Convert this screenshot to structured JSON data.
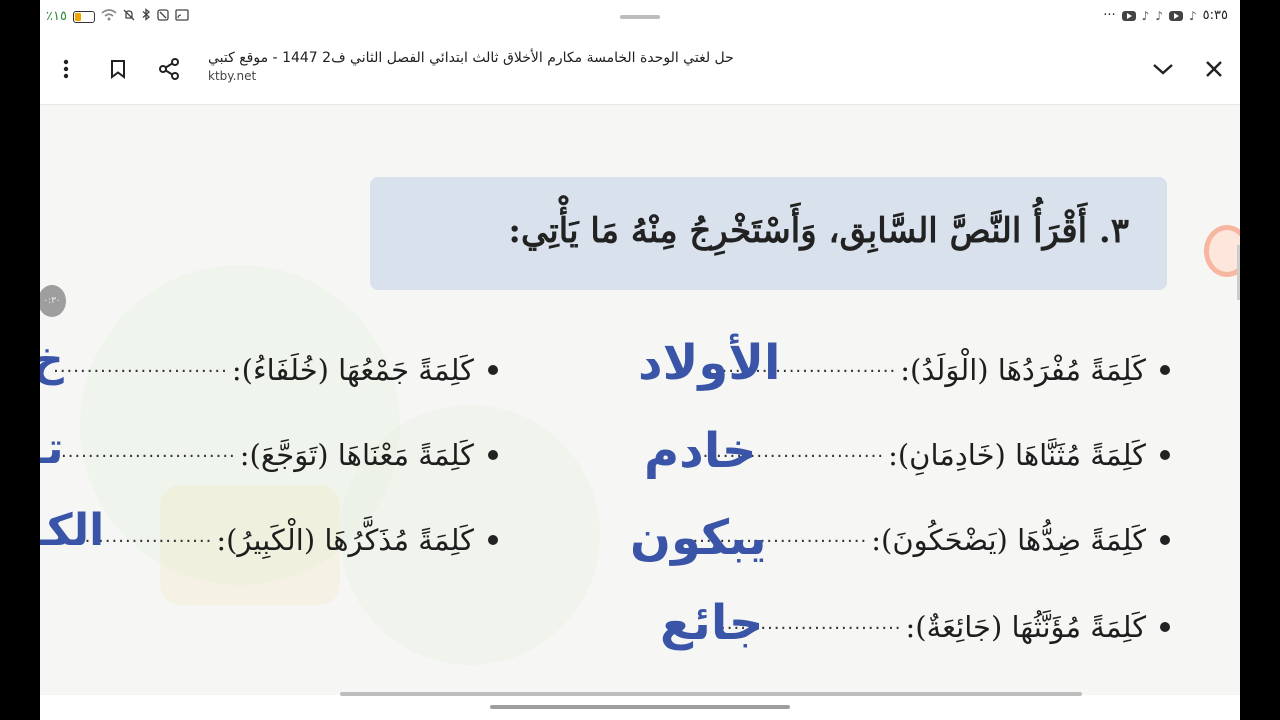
{
  "status_bar": {
    "time": "٥:٣٥",
    "battery": "٪١٥",
    "more": "···"
  },
  "toolbar": {
    "page_title": "حل لغتي الوحدة الخامسة مكارم الأخلاق ثالث ابتدائي الفصل الثاني ف2 1447 - موقع كتبي",
    "domain": "ktby.net"
  },
  "content": {
    "heading": "٣. أَقْرَأُ النَّصَّ السَّابِق، وَأَسْتَخْرِجُ مِنْهُ مَا يَأْتِي:",
    "right_rows": [
      {
        "prompt": "كَلِمَةً مُفْرَدُهَا (الْوَلَدُ):",
        "dots": "...........................",
        "answer": "الأولاد"
      },
      {
        "prompt": "كَلِمَةً مُثَنَّاهَا (خَادِمَانِ):",
        "dots": "...........................",
        "answer": "خادم"
      },
      {
        "prompt": "كَلِمَةً ضِدُّهَا (يَضْحَكُونَ):",
        "dots": "...........................",
        "answer": "يبكون"
      },
      {
        "prompt": "كَلِمَةً مُؤَنَّثُهَا (جَائِعَةٌ):",
        "dots": "...........................",
        "answer": "جائع"
      }
    ],
    "left_rows": [
      {
        "prompt": "كَلِمَةً جَمْعُهَا (خُلَفَاءُ):",
        "dots": "..........................",
        "answer_partial": "خ"
      },
      {
        "prompt": "كَلِمَةً مَعْنَاهَا (تَوَجَّعَ):",
        "dots": "..........................",
        "answer_partial": "تـ"
      },
      {
        "prompt": "كَلِمَةً مُذَكَّرُهَا (الْكَبِيرُ):",
        "dots": "..........................",
        "answer_partial": "الكـ"
      }
    ],
    "float_label": "٠:٣٠"
  },
  "icons": [
    "more-vert-icon",
    "bookmark-icon",
    "share-icon",
    "chevron-down-icon",
    "close-icon",
    "wifi-icon",
    "bluetooth-icon",
    "mute-icon",
    "cast-icon",
    "youtube-icon",
    "tiktok-icon"
  ]
}
